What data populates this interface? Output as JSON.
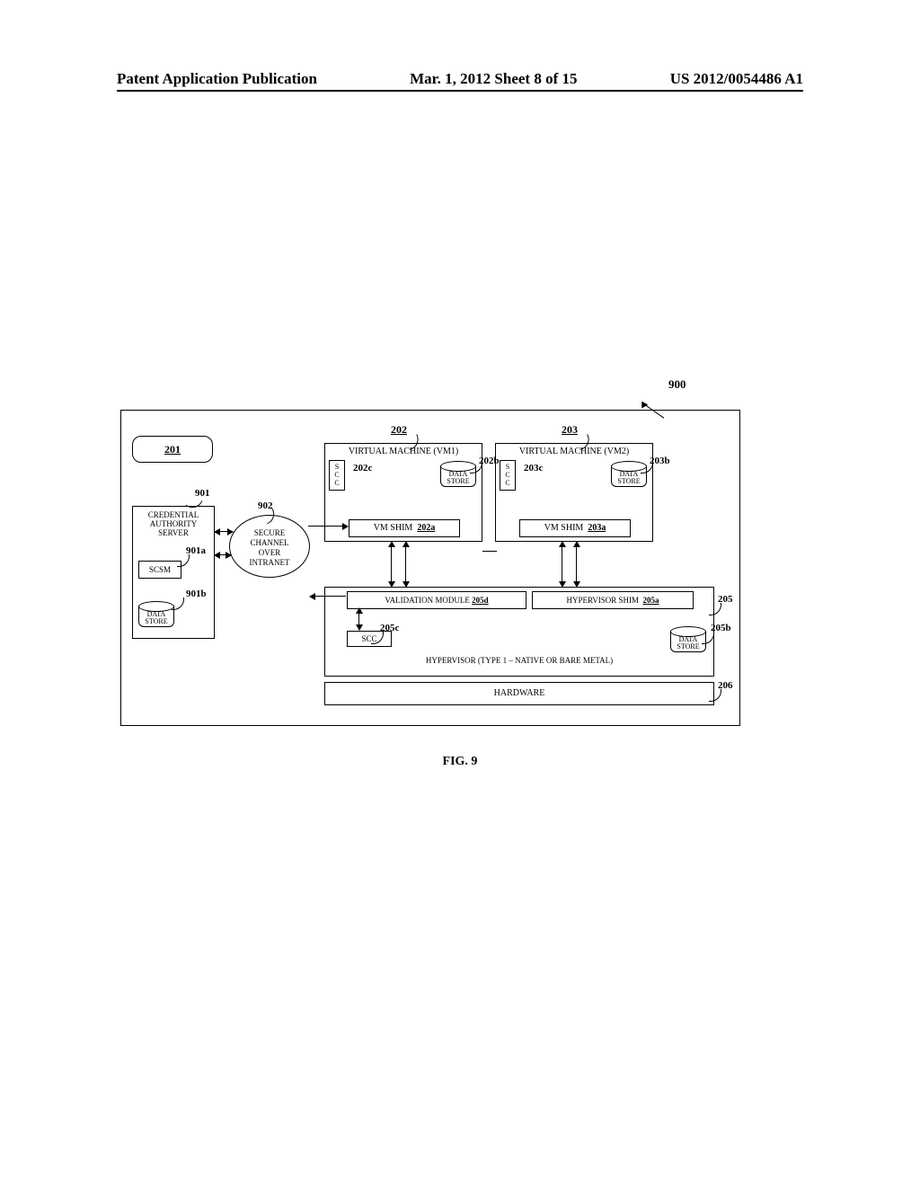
{
  "header": {
    "left": "Patent Application Publication",
    "center": "Mar. 1, 2012  Sheet 8 of 15",
    "right": "US 2012/0054486 A1"
  },
  "figure_label": "FIG. 9",
  "refs": {
    "r900": "900",
    "r201": "201",
    "r202": "202",
    "r203": "203",
    "r901": "901",
    "r902": "902",
    "r901a": "901a",
    "r901b": "901b",
    "r202a": "202a",
    "r202b": "202b",
    "r202c": "202c",
    "r203a": "203a",
    "r203b": "203b",
    "r203c": "203c",
    "r205": "205",
    "r205a": "205a",
    "r205b": "205b",
    "r205c": "205c",
    "r205d": "205d",
    "r206": "206"
  },
  "labels": {
    "vm1_title": "VIRTUAL MACHINE (VM1)",
    "vm2_title": "VIRTUAL MACHINE (VM2)",
    "scc_vert": "S\nC\nC",
    "data_store": "DATA\nSTORE",
    "vm_shim": "VM SHIM",
    "cred_server": "CREDENTIAL\nAUTHORITY\nSERVER",
    "scsm": "SCSM",
    "sec_channel": "SECURE\nCHANNEL\nOVER\nINTRANET",
    "validation_module": "VALIDATION MODULE",
    "hyp_shim": "HYPERVISOR SHIM",
    "scc": "SCC",
    "hypervisor": "HYPERVISOR (TYPE 1 – NATIVE OR BARE METAL)",
    "hardware": "HARDWARE"
  }
}
